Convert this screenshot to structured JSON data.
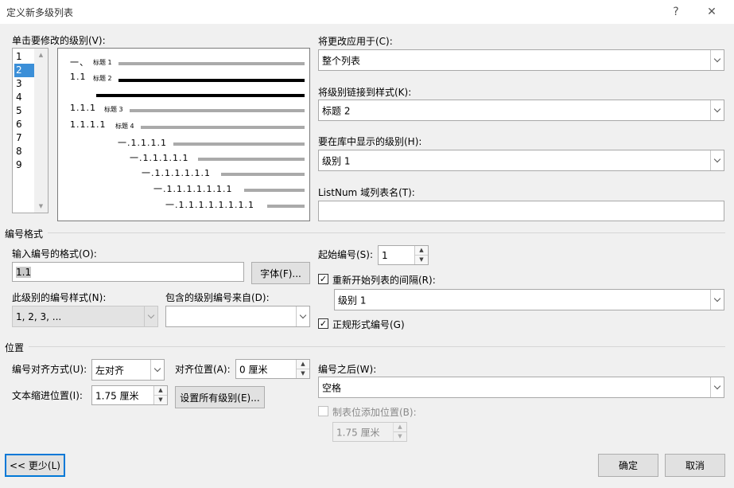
{
  "dialog": {
    "title": "定义新多级列表",
    "help": "?",
    "close": "✕"
  },
  "levels": {
    "label": "单击要修改的级别(V):",
    "items": [
      "1",
      "2",
      "3",
      "4",
      "5",
      "6",
      "7",
      "8",
      "9"
    ],
    "selected_index": 1
  },
  "preview": {
    "rows": [
      {
        "num": "一、",
        "head": "标题 1"
      },
      {
        "num": "1.1",
        "head": "标题 2"
      },
      {
        "num": "1.1.1",
        "head": "标题 3"
      },
      {
        "num": "1.1.1.1",
        "head": "标题 4"
      },
      {
        "num": "一.1.1.1.1"
      },
      {
        "num": "一.1.1.1.1.1"
      },
      {
        "num": "一.1.1.1.1.1.1"
      },
      {
        "num": "一.1.1.1.1.1.1.1"
      },
      {
        "num": "一.1.1.1.1.1.1.1.1"
      }
    ]
  },
  "apply_to": {
    "label": "将更改应用于(C):",
    "value": "整个列表"
  },
  "link_style": {
    "label": "将级别链接到样式(K):",
    "value": "标题 2"
  },
  "gallery_level": {
    "label": "要在库中显示的级别(H):",
    "value": "级别 1"
  },
  "listnum": {
    "label": "ListNum 域列表名(T):",
    "value": ""
  },
  "number_format": {
    "section": "编号格式",
    "format_label": "输入编号的格式(O):",
    "format_value": "1.1",
    "font_button": "字体(F)...",
    "style_label": "此级别的编号样式(N):",
    "style_value": "1, 2, 3, ...",
    "include_label": "包含的级别编号来自(D):",
    "include_value": "",
    "start_label": "起始编号(S):",
    "start_value": "1",
    "restart_label": "重新开始列表的间隔(R):",
    "restart_checked": true,
    "restart_value": "级别 1",
    "legal_label": "正规形式编号(G)",
    "legal_checked": true
  },
  "position": {
    "section": "位置",
    "align_label": "编号对齐方式(U):",
    "align_value": "左对齐",
    "align_at_label": "对齐位置(A):",
    "align_at_value": "0 厘米",
    "indent_label": "文本缩进位置(I):",
    "indent_value": "1.75 厘米",
    "set_all_button": "设置所有级别(E)...",
    "follow_label": "编号之后(W):",
    "follow_value": "空格",
    "tab_label": "制表位添加位置(B):",
    "tab_checked": false,
    "tab_value": "1.75 厘米"
  },
  "buttons": {
    "less": "<< 更少(L)",
    "ok": "确定",
    "cancel": "取消"
  },
  "colors": {
    "selection": "#3b8fd8",
    "focus_border": "#0078d7"
  }
}
